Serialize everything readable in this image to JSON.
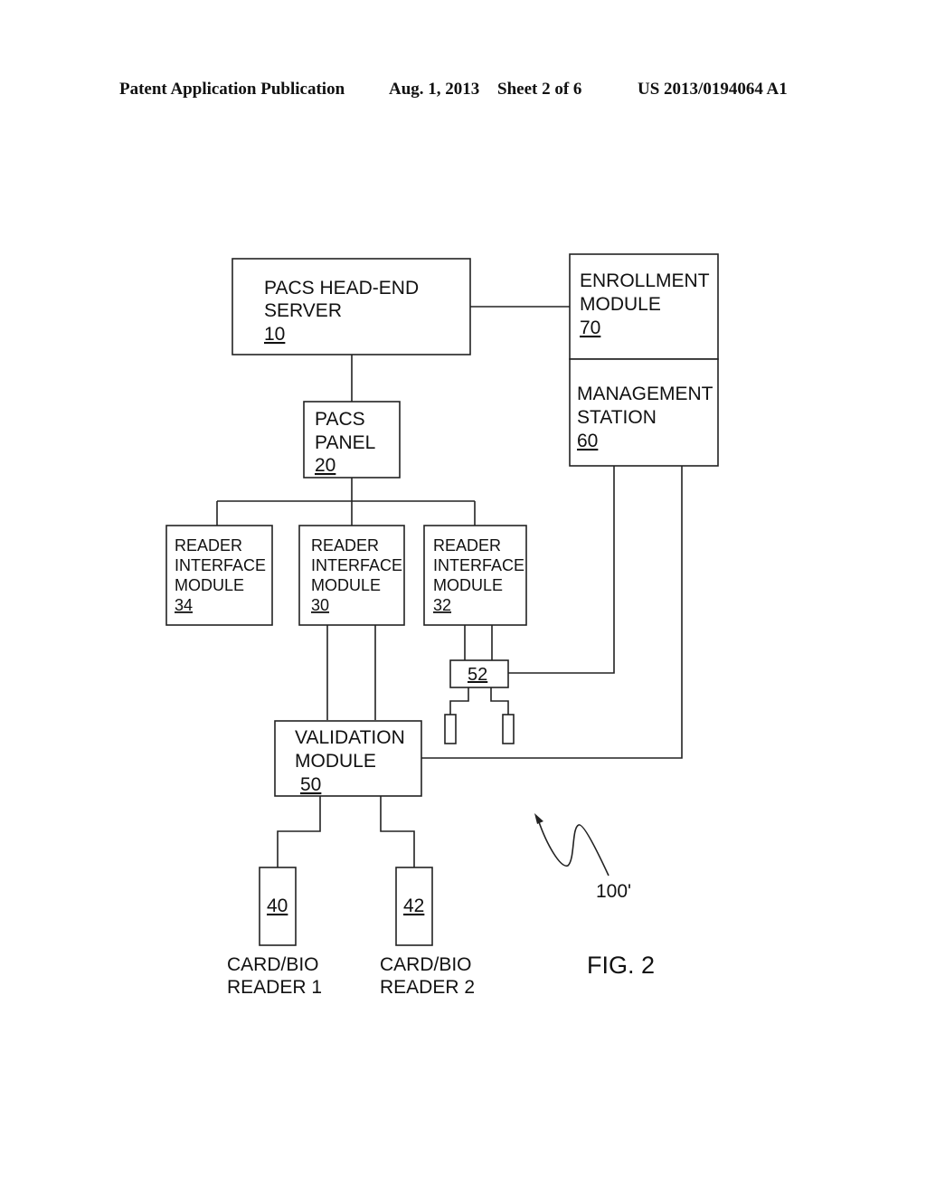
{
  "header": {
    "publication": "Patent Application Publication",
    "date": "Aug. 1, 2013",
    "sheet": "Sheet 2 of 6",
    "number": "US 2013/0194064 A1"
  },
  "blocks": {
    "server": {
      "lines": [
        "PACS HEAD-END",
        "SERVER"
      ],
      "ref": "10"
    },
    "panel": {
      "lines": [
        "PACS",
        "PANEL"
      ],
      "ref": "20"
    },
    "enrollment": {
      "lines": [
        "ENROLLMENT",
        "MODULE"
      ],
      "ref": "70"
    },
    "management": {
      "lines": [
        "MANAGEMENT",
        "STATION"
      ],
      "ref": "60"
    },
    "rim34": {
      "lines": [
        "READER",
        "INTERFACE",
        "MODULE"
      ],
      "ref": "34"
    },
    "rim30": {
      "lines": [
        "READER",
        "INTERFACE",
        "MODULE"
      ],
      "ref": "30"
    },
    "rim32": {
      "lines": [
        "READER",
        "INTERFACE",
        "MODULE"
      ],
      "ref": "32"
    },
    "hub": {
      "ref": "52"
    },
    "validation": {
      "lines": [
        "VALIDATION",
        "MODULE"
      ],
      "ref": "50"
    },
    "reader1": {
      "ref": "40",
      "caption": [
        "CARD/BIO",
        "READER 1"
      ]
    },
    "reader2": {
      "ref": "42",
      "caption": [
        "CARD/BIO",
        "READER 2"
      ]
    }
  },
  "figure": {
    "label": "FIG. 2",
    "system_ref": "100'"
  }
}
